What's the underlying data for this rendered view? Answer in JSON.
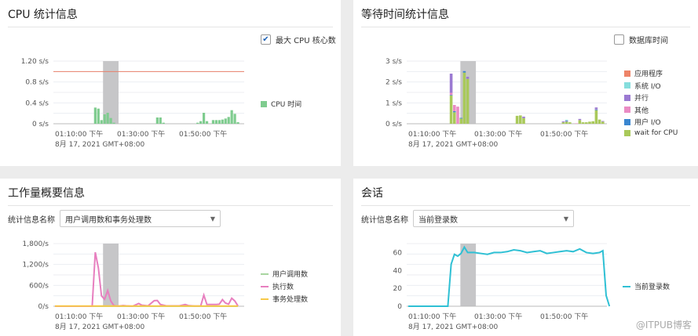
{
  "panels": {
    "cpu": {
      "title": "CPU 统计信息",
      "checkbox_label": "最大 CPU 核心数",
      "checked": true
    },
    "wait": {
      "title": "等待时间统计信息",
      "checkbox_label": "数据库时间",
      "checked": false
    },
    "workload": {
      "title": "工作量概要信息",
      "select_label": "统计信息名称",
      "select_value": "用户调用数和事务处理数"
    },
    "session": {
      "title": "会话",
      "select_label": "统计信息名称",
      "select_value": "当前登录数"
    }
  },
  "x_axis": {
    "labels": [
      "01:10:00 下午",
      "01:30:00 下午",
      "01:50:00 下午"
    ],
    "date": "8月 17, 2021 GMT+08:00"
  },
  "watermark": "@ITPUB博客",
  "chart_data": [
    {
      "type": "bar",
      "name": "cpu",
      "x_unit": "minutes after 01:10",
      "yticks": [
        "0 s/s",
        "0.4 s/s",
        "0.8 s/s",
        "1.20 s/s"
      ],
      "ylim": [
        0,
        1.2
      ],
      "max_line": 1.0,
      "max_line_color": "#e8806a",
      "highlight": [
        15.5,
        20.5
      ],
      "series": [
        {
          "name": "CPU 时间",
          "color": "#7fcc8f",
          "x": [
            13,
            14,
            15,
            16,
            17,
            18,
            19,
            33,
            34,
            35,
            46,
            47,
            48,
            49,
            51,
            52,
            53,
            54,
            55,
            56,
            57,
            58,
            59
          ],
          "values": [
            0.31,
            0.29,
            0.07,
            0.18,
            0.21,
            0.11,
            0.02,
            0.12,
            0.12,
            0.02,
            0.02,
            0.05,
            0.21,
            0.05,
            0.07,
            0.07,
            0.07,
            0.08,
            0.1,
            0.13,
            0.26,
            0.19,
            0.03
          ]
        }
      ]
    },
    {
      "type": "bar",
      "stacked": true,
      "name": "wait",
      "yticks": [
        "0 s/s",
        "1 s/s",
        "2 s/s",
        "3 s/s"
      ],
      "ylim": [
        0,
        3
      ],
      "highlight": [
        15.8,
        20.5
      ],
      "x": [
        13,
        14,
        15,
        16,
        17,
        18,
        33,
        34,
        35,
        47,
        48,
        49,
        51,
        52,
        53,
        54,
        55,
        56,
        57,
        58,
        59
      ],
      "series": [
        {
          "name": "应用程序",
          "color": "#ee8468",
          "values": [
            0,
            0,
            0,
            0,
            0,
            0,
            0,
            0,
            0,
            0,
            0,
            0,
            0,
            0,
            0,
            0,
            0,
            0,
            0,
            0,
            0
          ]
        },
        {
          "name": "系统 I/O",
          "color": "#86dedd",
          "values": [
            0,
            0,
            0,
            0,
            0,
            0,
            0,
            0,
            0,
            0,
            0.04,
            0,
            0,
            0,
            0,
            0,
            0,
            0,
            0,
            0,
            0
          ]
        },
        {
          "name": "并行",
          "color": "#9b7ad2",
          "values": [
            0.92,
            0,
            0,
            0,
            0,
            0.1,
            0,
            0,
            0.07,
            0.04,
            0.03,
            0,
            0,
            0.05,
            0,
            0,
            0,
            0,
            0.07,
            0,
            0.03
          ]
        },
        {
          "name": "其他",
          "color": "#ea8cc4",
          "values": [
            0.1,
            0.3,
            0.82,
            0,
            0,
            0,
            0,
            0,
            0,
            0,
            0,
            0,
            0.02,
            0.01,
            0,
            0,
            0,
            0,
            0.02,
            0,
            0
          ]
        },
        {
          "name": "用户 I/O",
          "color": "#3a86d0",
          "values": [
            0.03,
            0.05,
            0,
            0.03,
            0.07,
            0,
            0,
            0,
            0,
            0,
            0.02,
            0,
            0,
            0,
            0,
            0,
            0,
            0,
            0.04,
            0,
            0
          ]
        },
        {
          "name": "wait for CPU",
          "color": "#a9c95a",
          "values": [
            1.35,
            0.55,
            0,
            0.25,
            2.45,
            2.15,
            0.38,
            0.4,
            0.27,
            0.07,
            0.1,
            0.07,
            0,
            0.17,
            0.07,
            0.07,
            0.1,
            0.12,
            0.65,
            0.2,
            0.1
          ]
        }
      ]
    },
    {
      "type": "line",
      "name": "workload",
      "yticks": [
        "0/s",
        "600/s",
        "1,200/s",
        "1,800/s"
      ],
      "ylim": [
        0,
        1800
      ],
      "highlight": [
        15.5,
        20.5
      ],
      "x": [
        0,
        12,
        13,
        14,
        15,
        16,
        17,
        18,
        19,
        20,
        22,
        23,
        25,
        27,
        28,
        30,
        32,
        33,
        34,
        36,
        40,
        42,
        43,
        45,
        47,
        48,
        49,
        51,
        52,
        53,
        54,
        55,
        56,
        57,
        58,
        59
      ],
      "series": [
        {
          "name": "用户调用数",
          "color": "#a8d5a0",
          "values": [
            0,
            0,
            0,
            0,
            0,
            0,
            0,
            0,
            0,
            0,
            0,
            0,
            0,
            0,
            0,
            0,
            0,
            0,
            0,
            0,
            0,
            0,
            0,
            0,
            0,
            0,
            0,
            0,
            0,
            0,
            0,
            0,
            0,
            0,
            0,
            0
          ]
        },
        {
          "name": "执行数",
          "color": "#e77fbf",
          "values": [
            0,
            0,
            1550,
            1100,
            300,
            200,
            450,
            150,
            20,
            0,
            20,
            10,
            0,
            80,
            30,
            10,
            160,
            165,
            50,
            10,
            10,
            50,
            20,
            5,
            10,
            320,
            50,
            50,
            50,
            60,
            190,
            90,
            60,
            230,
            150,
            10
          ]
        },
        {
          "name": "事务处理数",
          "color": "#f7c948",
          "values": [
            5,
            5,
            5,
            5,
            5,
            5,
            5,
            5,
            5,
            5,
            5,
            5,
            5,
            5,
            5,
            5,
            5,
            5,
            5,
            5,
            5,
            5,
            5,
            5,
            5,
            5,
            5,
            5,
            5,
            5,
            5,
            5,
            5,
            5,
            5,
            5
          ]
        }
      ]
    },
    {
      "type": "line",
      "name": "session",
      "yticks": [
        "0",
        "20",
        "40",
        "60"
      ],
      "ylim": [
        0,
        70
      ],
      "highlight": [
        15.8,
        20.5
      ],
      "x": [
        0,
        12,
        13,
        14,
        15,
        16,
        17,
        18,
        20,
        22,
        24,
        26,
        28,
        30,
        32,
        34,
        36,
        38,
        40,
        42,
        44,
        46,
        48,
        50,
        52,
        54,
        56,
        58,
        59,
        60,
        61
      ],
      "series": [
        {
          "name": "当前登录数",
          "color": "#2fc0d4",
          "values": [
            0,
            0,
            47,
            58,
            56,
            59,
            66,
            60,
            60,
            59,
            58,
            60,
            60,
            61,
            63,
            62,
            60,
            61,
            62,
            59,
            60,
            61,
            62,
            61,
            64,
            60,
            59,
            60,
            62,
            12,
            0
          ]
        }
      ]
    }
  ]
}
